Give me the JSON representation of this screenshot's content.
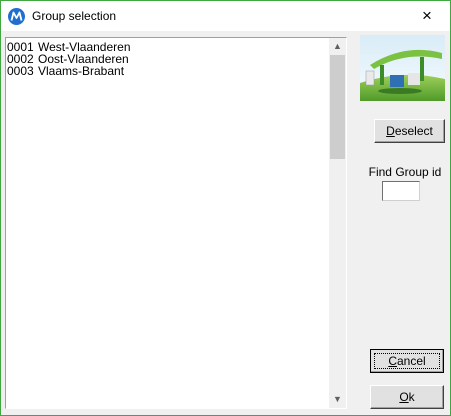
{
  "window": {
    "title": "Group selection",
    "close_label": "×",
    "accent_color": "#3fa83f"
  },
  "icons": {
    "app": "app-logo-icon",
    "close": "close-icon",
    "scroll_up": "chevron-up-icon",
    "scroll_down": "chevron-down-icon",
    "logo": "gas-station-image"
  },
  "groups": [
    {
      "code": "0001",
      "name": "West-Vlaanderen"
    },
    {
      "code": "0002",
      "name": "Oost-Vlaanderen"
    },
    {
      "code": "0003",
      "name": "Vlaams-Brabant"
    }
  ],
  "buttons": {
    "deselect": {
      "accel": "D",
      "rest": "eselect"
    },
    "cancel": {
      "accel": "C",
      "rest": "ancel"
    },
    "ok": {
      "accel": "O",
      "rest": "k"
    }
  },
  "find": {
    "label": "Find Group id",
    "value": ""
  }
}
